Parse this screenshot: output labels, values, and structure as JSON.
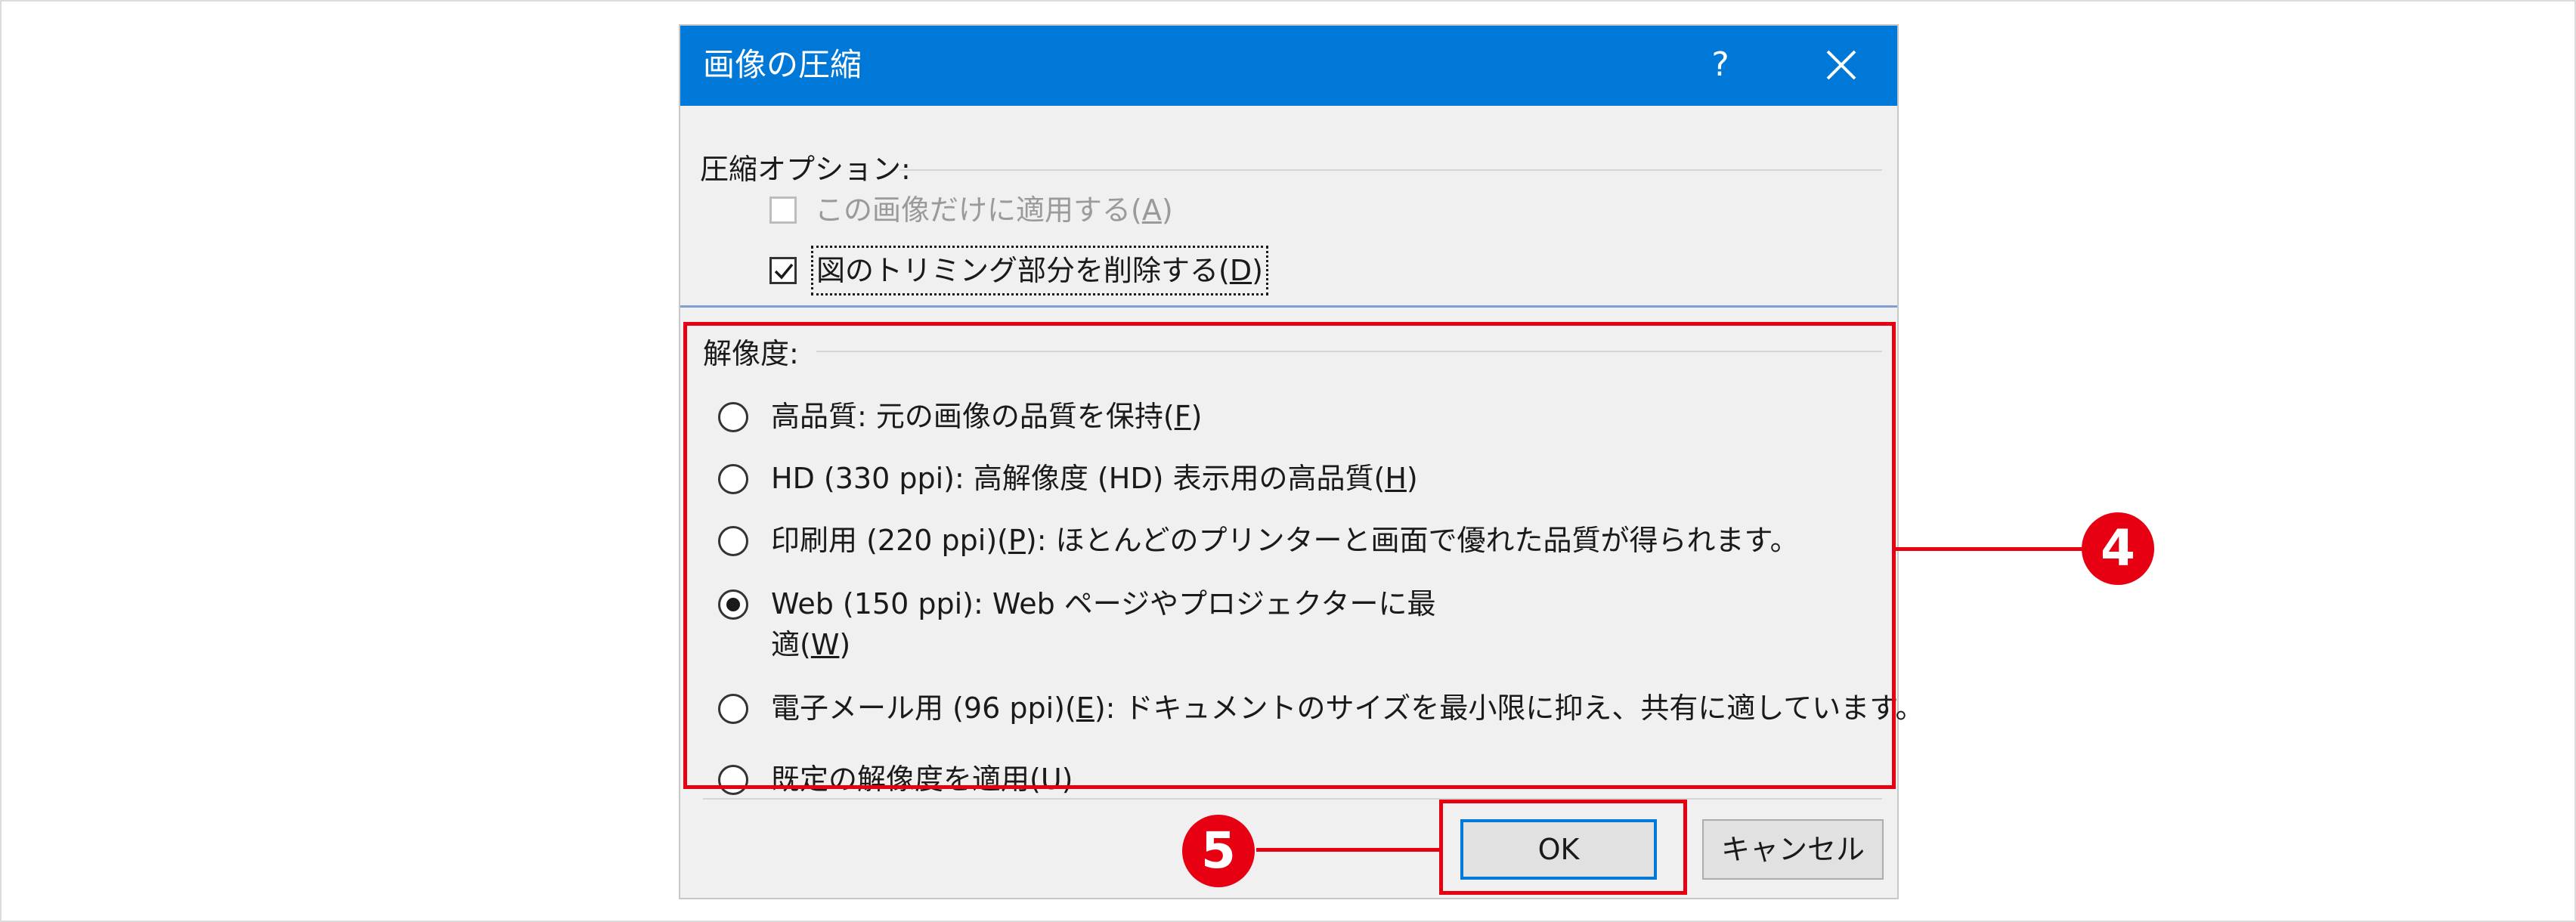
{
  "dialog": {
    "title": "画像の圧縮",
    "help_label": "?",
    "compression_group_label": "圧縮オプション:",
    "options": [
      {
        "pre": "この画像だけに適用する(",
        "key": "A",
        "post": ")",
        "checked": false,
        "enabled": false
      },
      {
        "pre": "図のトリミング部分を削除する(",
        "key": "D",
        "post": ")",
        "checked": true,
        "enabled": true
      }
    ],
    "resolution_group_label": "解像度:",
    "resolutions": [
      {
        "pre": "高品質: 元の画像の品質を保持(",
        "key": "F",
        "post": ")",
        "selected": false
      },
      {
        "pre": "HD (330 ppi): 高解像度 (HD) 表示用の高品質(",
        "key": "H",
        "post": ")",
        "selected": false
      },
      {
        "pre": "印刷用 (220 ppi)(",
        "key": "P",
        "post": "): ほとんどのプリンターと画面で優れた品質が得られます。",
        "selected": false
      },
      {
        "pre": "Web (150 ppi): Web ページやプロジェクターに最適(",
        "key": "W",
        "post": ")",
        "selected": true
      },
      {
        "pre": "電子メール用 (96 ppi)(",
        "key": "E",
        "post": "): ドキュメントのサイズを最小限に抑え、共有に適しています。",
        "selected": false
      },
      {
        "pre": "既定の解像度を適用(",
        "key": "U",
        "post": ")",
        "selected": false
      }
    ],
    "ok_label": "OK",
    "cancel_label": "キャンセル"
  },
  "annotations": {
    "step4": "4",
    "step5": "5",
    "color": "#e60012"
  },
  "colors": {
    "titlebar": "#0078d7",
    "dialog_bg": "#f0f0f0"
  }
}
